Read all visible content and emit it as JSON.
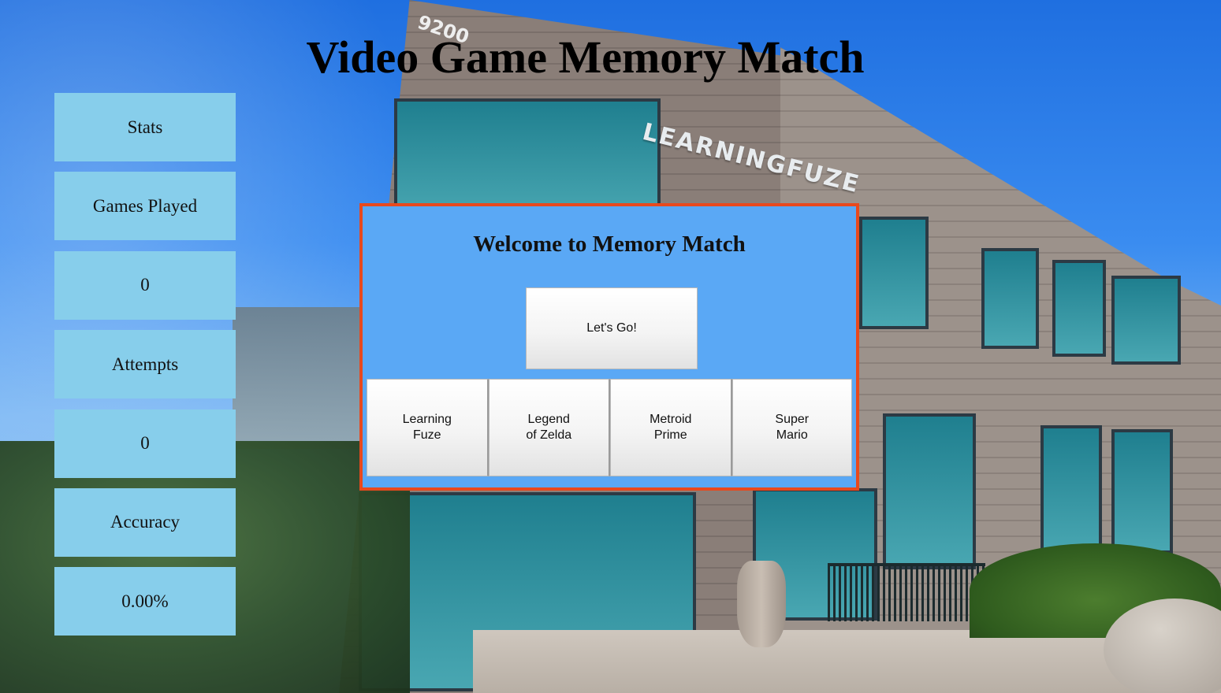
{
  "title": "Video Game Memory Match",
  "stats": {
    "header": "Stats",
    "games_played_label": "Games Played",
    "games_played_value": "0",
    "attempts_label": "Attempts",
    "attempts_value": "0",
    "accuracy_label": "Accuracy",
    "accuracy_value": "0.00%"
  },
  "modal": {
    "title": "Welcome to Memory Match",
    "start_button": "Let's Go!",
    "themes": [
      {
        "label": "Learning\nFuze"
      },
      {
        "label": "Legend\nof Zelda"
      },
      {
        "label": "Metroid\nPrime"
      },
      {
        "label": "Super\nMario"
      }
    ]
  },
  "background": {
    "building_number": "9200",
    "building_sign": "LEARNINGFUZE"
  },
  "colors": {
    "stat_box": "#87ceeb",
    "modal_bg": "#5aa8f5",
    "modal_border": "#e8491d",
    "title_text": "#000000"
  }
}
